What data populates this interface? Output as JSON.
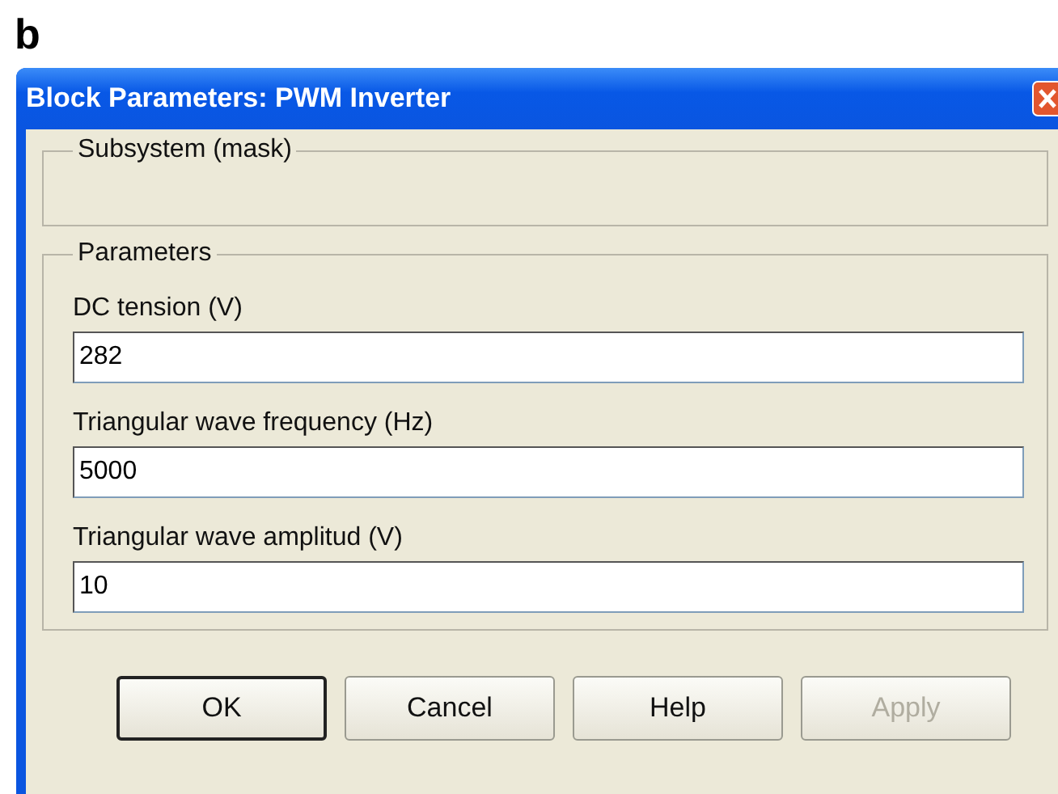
{
  "figure_label": "b",
  "window": {
    "title": "Block Parameters: PWM Inverter"
  },
  "groups": [
    {
      "title": "Subsystem (mask)"
    },
    {
      "title": "Parameters",
      "fields": [
        {
          "label": "DC tension (V)",
          "value": "282"
        },
        {
          "label": "Triangular wave frequency (Hz)",
          "value": "5000"
        },
        {
          "label": "Triangular wave amplitud (V)",
          "value": "10"
        }
      ]
    }
  ],
  "buttons": [
    {
      "label": "OK",
      "default": true,
      "disabled": false
    },
    {
      "label": "Cancel",
      "default": false,
      "disabled": false
    },
    {
      "label": "Help",
      "default": false,
      "disabled": false
    },
    {
      "label": "Apply",
      "default": false,
      "disabled": true
    }
  ]
}
